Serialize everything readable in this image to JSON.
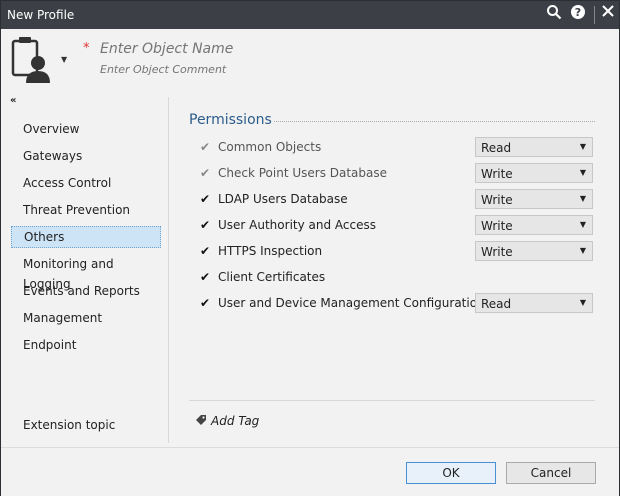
{
  "window": {
    "title": "New Profile"
  },
  "header": {
    "name_placeholder": "Enter Object Name",
    "comment_placeholder": "Enter Object Comment",
    "required_mark": "*"
  },
  "sidebar": {
    "collapse_glyph": "«",
    "items": [
      {
        "label": "Overview"
      },
      {
        "label": "Gateways"
      },
      {
        "label": "Access Control"
      },
      {
        "label": "Threat Prevention"
      },
      {
        "label": "Others",
        "active": true
      },
      {
        "label": "Monitoring and Logging"
      },
      {
        "label": "Events and Reports"
      },
      {
        "label": "Management"
      },
      {
        "label": "Endpoint"
      }
    ],
    "extension_label": "Extension topic"
  },
  "permissions": {
    "title": "Permissions",
    "rows": [
      {
        "label": "Common Objects",
        "checked": true,
        "enabled": false,
        "value": "Read"
      },
      {
        "label": "Check Point Users Database",
        "checked": true,
        "enabled": false,
        "value": "Write"
      },
      {
        "label": "LDAP Users Database",
        "checked": true,
        "enabled": true,
        "value": "Write"
      },
      {
        "label": "User Authority and Access",
        "checked": true,
        "enabled": true,
        "value": "Write"
      },
      {
        "label": "HTTPS Inspection",
        "checked": true,
        "enabled": true,
        "value": "Write"
      },
      {
        "label": "Client Certificates",
        "checked": true,
        "enabled": true,
        "value": null
      },
      {
        "label": "User and Device Management Configuration",
        "checked": true,
        "enabled": true,
        "value": "Read"
      }
    ]
  },
  "tag": {
    "label": "Add Tag"
  },
  "footer": {
    "ok_label": "OK",
    "cancel_label": "Cancel"
  },
  "colors": {
    "accent": "#2c5c8a",
    "active_nav": "#cde4f7",
    "titlebar": "#3c3f45"
  }
}
